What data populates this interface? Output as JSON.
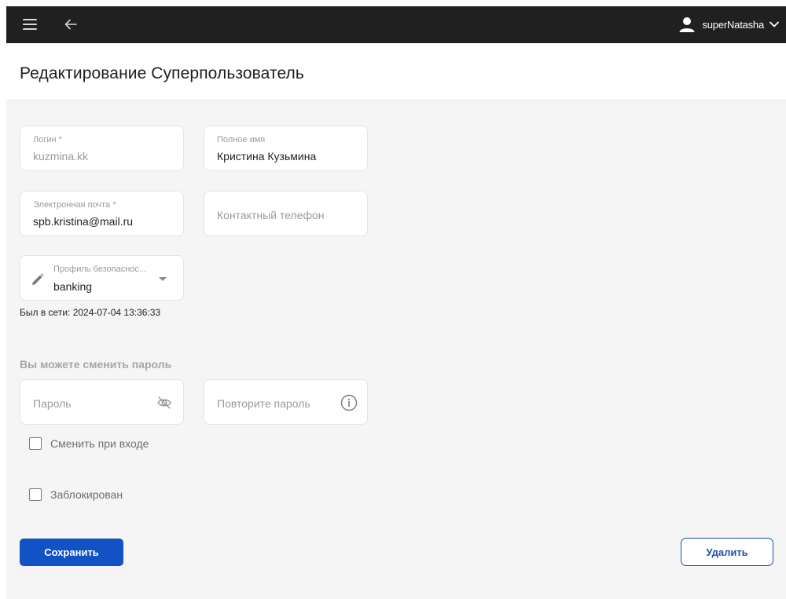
{
  "header": {
    "username": "superNatasha",
    "icons": {
      "menu": "hamburger-menu-icon",
      "back": "arrow-left-icon",
      "user": "user-icon",
      "dropdown": "chevron-down-icon"
    }
  },
  "page": {
    "title": "Редактирование Суперпользователь"
  },
  "form": {
    "login": {
      "label": "Логин *",
      "value": "kuzmina.kk"
    },
    "full_name": {
      "label": "Полное имя",
      "value": "Кристина Кузьмина"
    },
    "email": {
      "label": "Электронная почта *",
      "value": "spb.kristina@mail.ru"
    },
    "phone": {
      "placeholder": "Контактный телефон"
    },
    "security_profile": {
      "label": "Профиль безопаснос...",
      "value": "banking"
    },
    "last_seen": "Был в сети: 2024-07-04 13:36:33"
  },
  "password_section": {
    "title": "Вы можете сменить пароль",
    "password": {
      "placeholder": "Пароль"
    },
    "repeat_password": {
      "placeholder": "Повторите пароль"
    },
    "change_on_login": {
      "label": "Сменить при входе",
      "checked": false
    },
    "blocked": {
      "label": "Заблокирован",
      "checked": false
    }
  },
  "actions": {
    "save_label": "Сохранить",
    "delete_label": "Удалить"
  },
  "colors": {
    "topbar": "#202020",
    "primary": "#1252c4",
    "content_bg": "#f5f5f5"
  }
}
